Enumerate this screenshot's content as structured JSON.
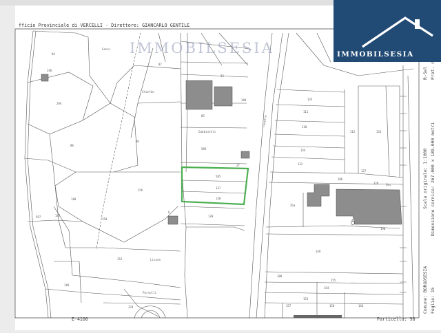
{
  "header": {
    "office": "fficio Provinciale di VERCELLI - Direttore: GIANCARLO GENTILE"
  },
  "watermark": "IMMOBILSESIA",
  "logo": {
    "name": "IMMOBILSESIA",
    "color": "#214a74"
  },
  "footer": {
    "left_code": "E-4100",
    "parcel_label": "Particella: 98"
  },
  "side": {
    "prot": "Prot. n. T1",
    "date": "R-Sel",
    "scale": "Scala originale: 1:1000",
    "dimension": "Dimensione cornice: 267.000 x 189.000 metri",
    "comune": "Comune: BORGOSESIA",
    "foglio": "Foglio: 15"
  },
  "place_names": [
    "Sonvi",
    "Chiefde",
    "Gabbinetti",
    "Lisone",
    "Porselli",
    "Ges",
    "Cemette"
  ],
  "parcels": [
    "84",
    "246",
    "294",
    "88",
    "86",
    "87",
    "93",
    "340",
    "85",
    "589",
    "27",
    "585",
    "137",
    "138",
    "139",
    "156",
    "140",
    "147",
    "597",
    "150",
    "152",
    "148",
    "370",
    "135",
    "111",
    "110",
    "112",
    "134",
    "132",
    "133",
    "127",
    "186",
    "190",
    "128",
    "2ba",
    "149",
    "155",
    "154",
    "153",
    "157",
    "158",
    "146",
    "188",
    "4",
    "6"
  ],
  "highlight_color": "#4caf50"
}
